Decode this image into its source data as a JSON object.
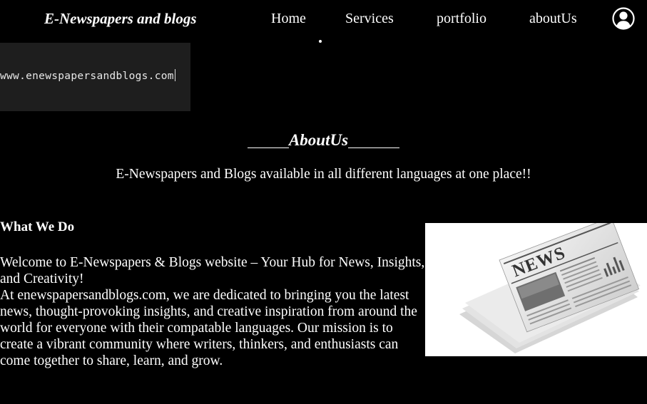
{
  "header": {
    "brand": "E-Newspapers and blogs",
    "nav": {
      "home": "Home",
      "services": "Services",
      "portfolio": "portfolio",
      "about": "aboutUs"
    },
    "user_icon": "user-circle-icon"
  },
  "banner": {
    "url": "www.enewspapersandblogs.com"
  },
  "about": {
    "heading": "AboutUs",
    "tagline": "E-Newspapers and Blogs available in all different languages at one place!!"
  },
  "what_we_do": {
    "title": "What We Do",
    "paragraph1": "Welcome to E-Newspapers & Blogs website – Your Hub for News, Insights, and Creativity!",
    "paragraph2": "At enewspapersandblogs.com, we are dedicated to bringing you the latest news, thought-provoking insights, and creative inspiration from around the world for everyone with their compatable languages. Our mission is to create a vibrant community where writers, thinkers, and enthusiasts can come together to share, learn, and grow."
  },
  "news_image": {
    "masthead": "NEWS"
  }
}
